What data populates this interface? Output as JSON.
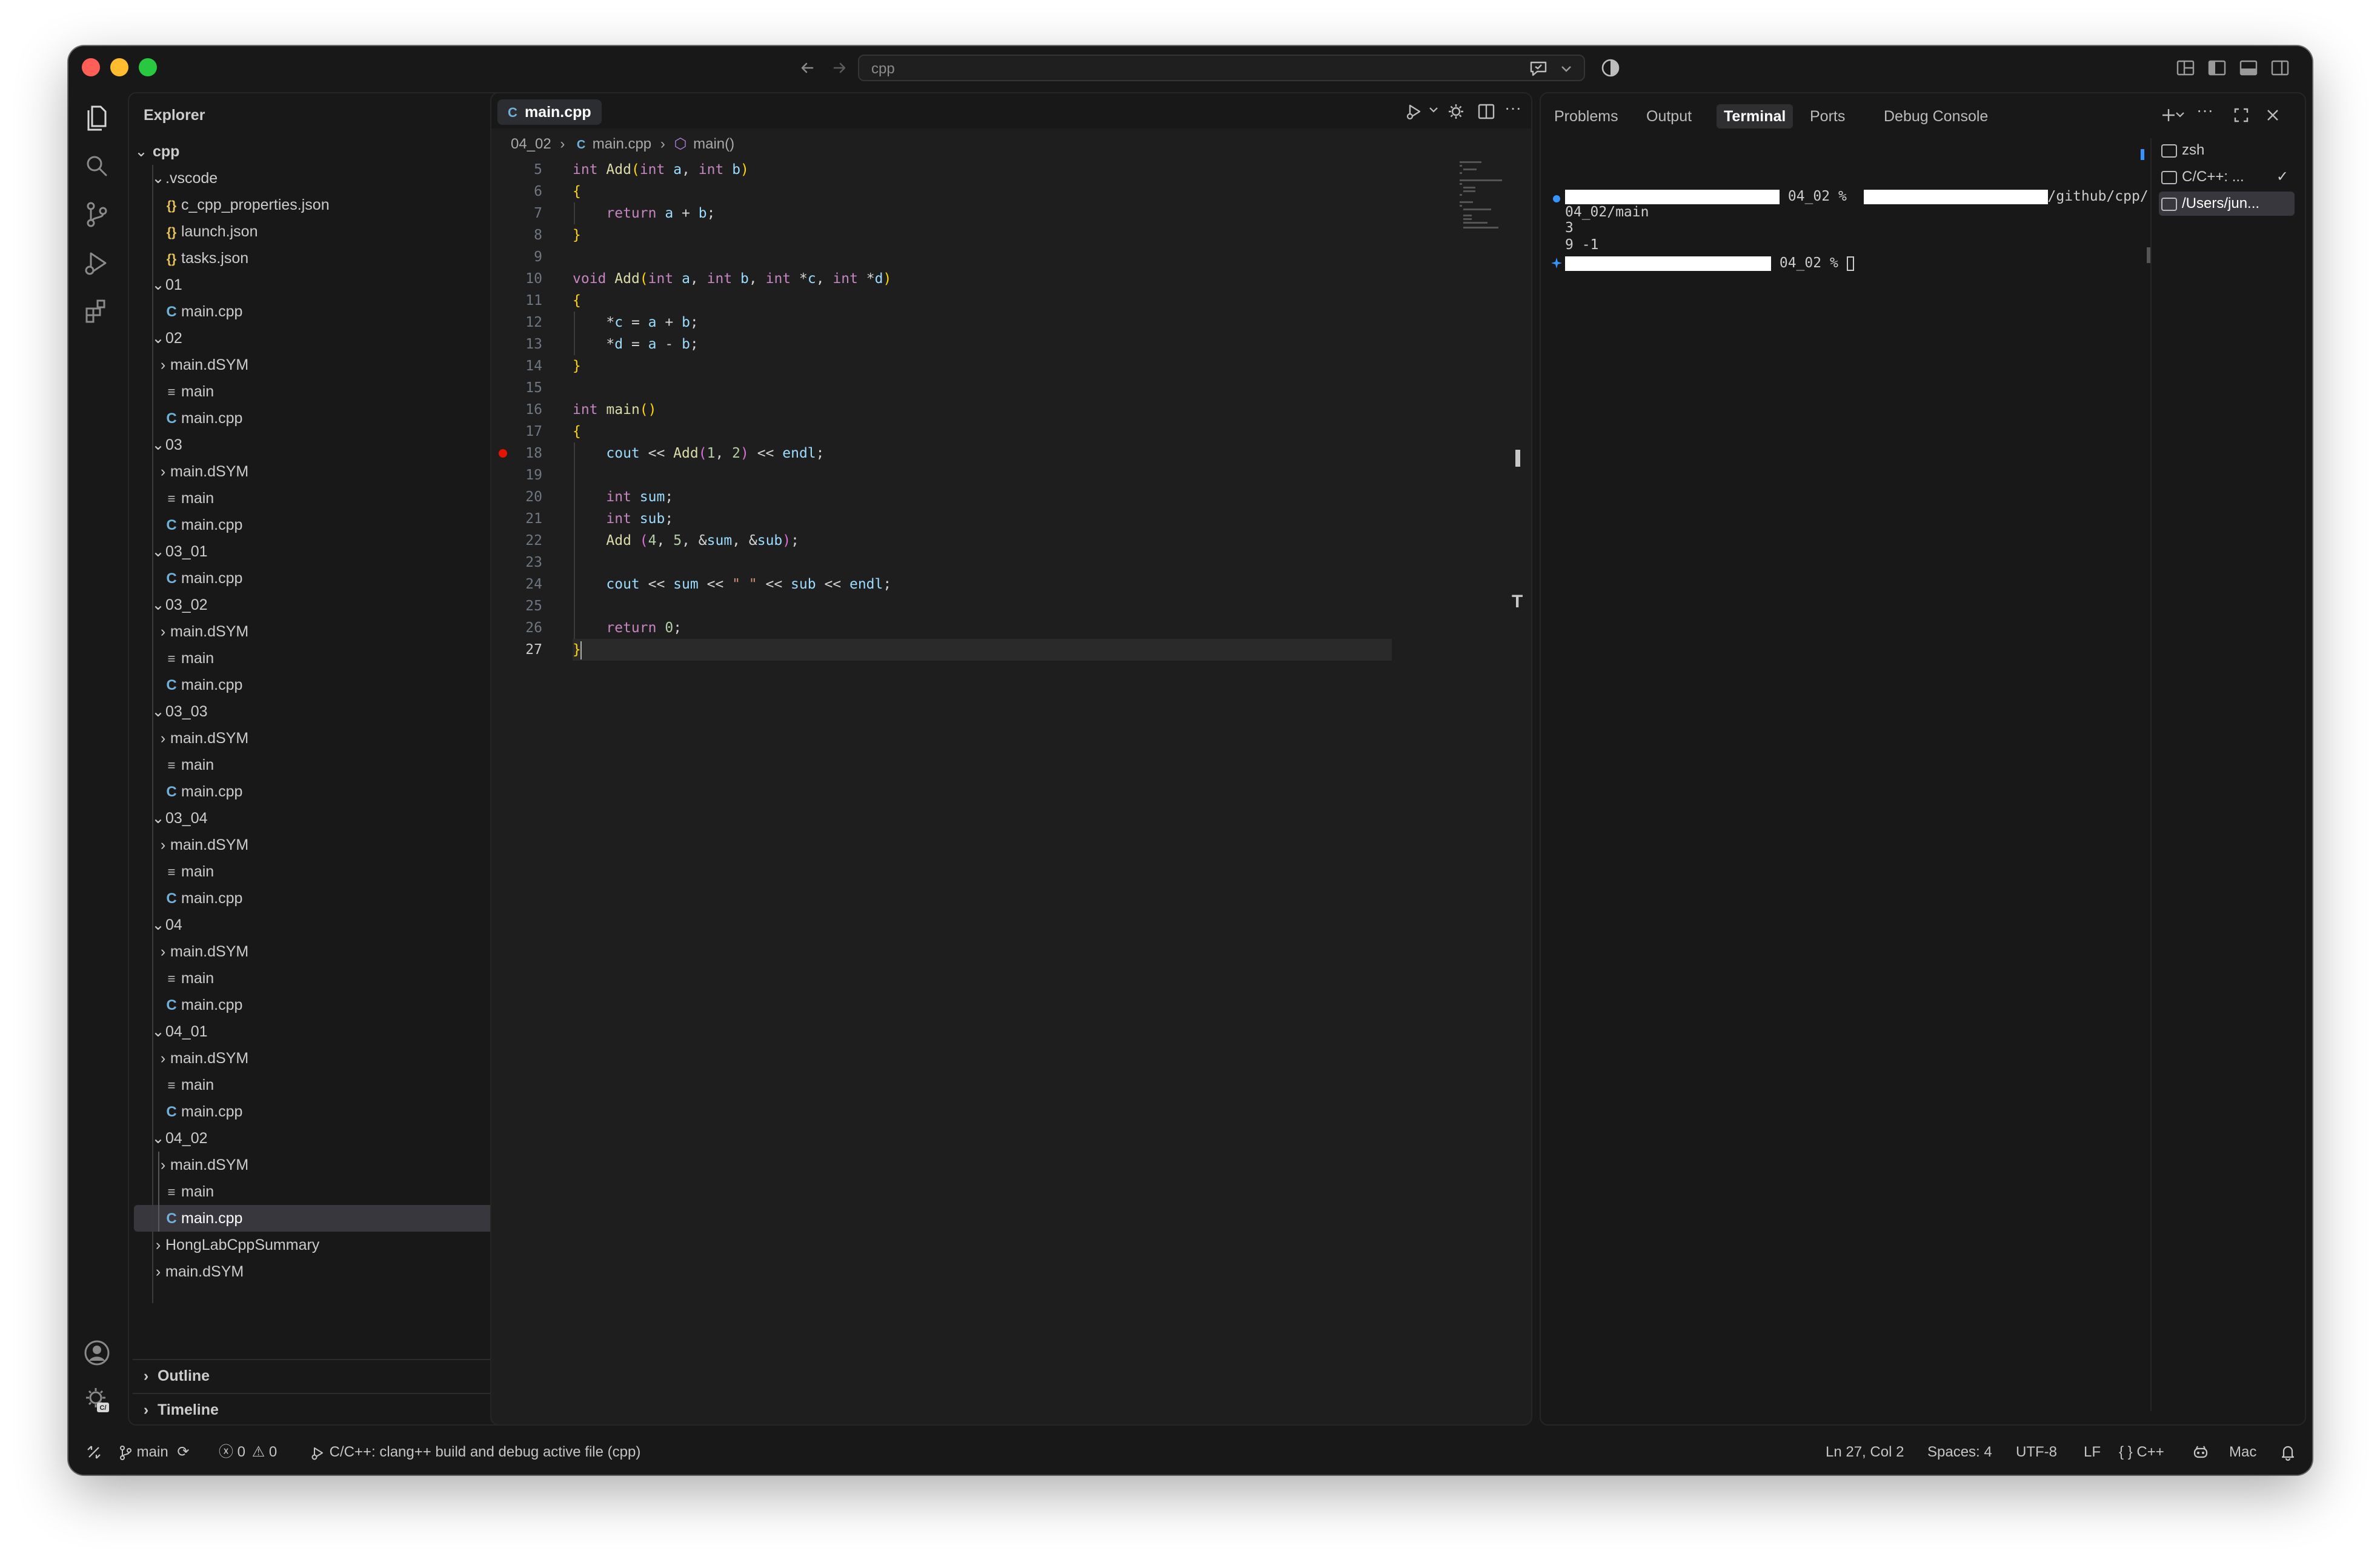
{
  "window": {
    "search_text": "cpp"
  },
  "sidebar": {
    "title": "Explorer",
    "more": "···",
    "root": "cpp",
    "items": [
      {
        "label": ".vscode",
        "kind": "folder-open"
      },
      {
        "label": "c_cpp_properties.json",
        "kind": "json"
      },
      {
        "label": "launch.json",
        "kind": "json"
      },
      {
        "label": "tasks.json",
        "kind": "json"
      },
      {
        "label": "01",
        "kind": "folder-open"
      },
      {
        "label": "main.cpp",
        "kind": "cpp"
      },
      {
        "label": "02",
        "kind": "folder-open"
      },
      {
        "label": "main.dSYM",
        "kind": "folder-closed"
      },
      {
        "label": "main",
        "kind": "bin"
      },
      {
        "label": "main.cpp",
        "kind": "cpp"
      },
      {
        "label": "03",
        "kind": "folder-open"
      },
      {
        "label": "main.dSYM",
        "kind": "folder-closed"
      },
      {
        "label": "main",
        "kind": "bin"
      },
      {
        "label": "main.cpp",
        "kind": "cpp"
      },
      {
        "label": "03_01",
        "kind": "folder-open"
      },
      {
        "label": "main.cpp",
        "kind": "cpp"
      },
      {
        "label": "03_02",
        "kind": "folder-open"
      },
      {
        "label": "main.dSYM",
        "kind": "folder-closed"
      },
      {
        "label": "main",
        "kind": "bin"
      },
      {
        "label": "main.cpp",
        "kind": "cpp"
      },
      {
        "label": "03_03",
        "kind": "folder-open"
      },
      {
        "label": "main.dSYM",
        "kind": "folder-closed"
      },
      {
        "label": "main",
        "kind": "bin"
      },
      {
        "label": "main.cpp",
        "kind": "cpp"
      },
      {
        "label": "03_04",
        "kind": "folder-open"
      },
      {
        "label": "main.dSYM",
        "kind": "folder-closed"
      },
      {
        "label": "main",
        "kind": "bin"
      },
      {
        "label": "main.cpp",
        "kind": "cpp"
      },
      {
        "label": "04",
        "kind": "folder-open"
      },
      {
        "label": "main.dSYM",
        "kind": "folder-closed"
      },
      {
        "label": "main",
        "kind": "bin"
      },
      {
        "label": "main.cpp",
        "kind": "cpp"
      },
      {
        "label": "04_01",
        "kind": "folder-open"
      },
      {
        "label": "main.dSYM",
        "kind": "folder-closed"
      },
      {
        "label": "main",
        "kind": "bin"
      },
      {
        "label": "main.cpp",
        "kind": "cpp"
      },
      {
        "label": "04_02",
        "kind": "folder-open"
      },
      {
        "label": "main.dSYM",
        "kind": "folder-closed"
      },
      {
        "label": "main",
        "kind": "bin"
      },
      {
        "label": "main.cpp",
        "kind": "cpp",
        "selected": true
      },
      {
        "label": "HongLabCppSummary",
        "kind": "folder-closed"
      },
      {
        "label": "main.dSYM",
        "kind": "folder-closed"
      }
    ],
    "outline": "Outline",
    "timeline": "Timeline"
  },
  "editor": {
    "tab_label": "main.cpp",
    "breadcrumb": {
      "folder": "04_02",
      "file": "main.cpp",
      "symbol": "main()"
    },
    "lines": [
      {
        "n": "5",
        "tokens": [
          [
            "ty",
            "int"
          ],
          [
            "op",
            " "
          ],
          [
            "fn",
            "Add"
          ],
          [
            "br",
            "("
          ],
          [
            "ty",
            "int"
          ],
          [
            "op",
            " "
          ],
          [
            "pm",
            "a"
          ],
          [
            "op",
            ", "
          ],
          [
            "ty",
            "int"
          ],
          [
            "op",
            " "
          ],
          [
            "pm",
            "b"
          ],
          [
            "br",
            ")"
          ]
        ]
      },
      {
        "n": "6",
        "tokens": [
          [
            "br",
            "{"
          ]
        ]
      },
      {
        "n": "7",
        "tokens": [
          [
            "op",
            "    "
          ],
          [
            "kw",
            "return"
          ],
          [
            "op",
            " "
          ],
          [
            "pm",
            "a"
          ],
          [
            "op",
            " + "
          ],
          [
            "pm",
            "b"
          ],
          [
            "op",
            ";"
          ]
        ]
      },
      {
        "n": "8",
        "tokens": [
          [
            "br",
            "}"
          ]
        ]
      },
      {
        "n": "9",
        "tokens": []
      },
      {
        "n": "10",
        "tokens": [
          [
            "ty",
            "void"
          ],
          [
            "op",
            " "
          ],
          [
            "fn",
            "Add"
          ],
          [
            "br",
            "("
          ],
          [
            "ty",
            "int"
          ],
          [
            "op",
            " "
          ],
          [
            "pm",
            "a"
          ],
          [
            "op",
            ", "
          ],
          [
            "ty",
            "int"
          ],
          [
            "op",
            " "
          ],
          [
            "pm",
            "b"
          ],
          [
            "op",
            ", "
          ],
          [
            "ty",
            "int"
          ],
          [
            "op",
            " *"
          ],
          [
            "pm",
            "c"
          ],
          [
            "op",
            ", "
          ],
          [
            "ty",
            "int"
          ],
          [
            "op",
            " *"
          ],
          [
            "pm",
            "d"
          ],
          [
            "br",
            ")"
          ]
        ]
      },
      {
        "n": "11",
        "tokens": [
          [
            "br",
            "{"
          ]
        ]
      },
      {
        "n": "12",
        "tokens": [
          [
            "op",
            "    *"
          ],
          [
            "pm",
            "c"
          ],
          [
            "op",
            " = "
          ],
          [
            "pm",
            "a"
          ],
          [
            "op",
            " + "
          ],
          [
            "pm",
            "b"
          ],
          [
            "op",
            ";"
          ]
        ]
      },
      {
        "n": "13",
        "tokens": [
          [
            "op",
            "    *"
          ],
          [
            "pm",
            "d"
          ],
          [
            "op",
            " = "
          ],
          [
            "pm",
            "a"
          ],
          [
            "op",
            " - "
          ],
          [
            "pm",
            "b"
          ],
          [
            "op",
            ";"
          ]
        ]
      },
      {
        "n": "14",
        "tokens": [
          [
            "br",
            "}"
          ]
        ]
      },
      {
        "n": "15",
        "tokens": []
      },
      {
        "n": "16",
        "tokens": [
          [
            "ty",
            "int"
          ],
          [
            "op",
            " "
          ],
          [
            "fn",
            "main"
          ],
          [
            "br",
            "()"
          ]
        ]
      },
      {
        "n": "17",
        "tokens": [
          [
            "br",
            "{"
          ]
        ]
      },
      {
        "n": "18",
        "tokens": [
          [
            "op",
            "    "
          ],
          [
            "pm",
            "cout"
          ],
          [
            "op",
            " << "
          ],
          [
            "fn",
            "Add"
          ],
          [
            "br2",
            "("
          ],
          [
            "nu",
            "1"
          ],
          [
            "op",
            ", "
          ],
          [
            "nu",
            "2"
          ],
          [
            "br2",
            ")"
          ],
          [
            "op",
            " << "
          ],
          [
            "pm",
            "endl"
          ],
          [
            "op",
            ";"
          ]
        ],
        "breakpoint": true
      },
      {
        "n": "19",
        "tokens": []
      },
      {
        "n": "20",
        "tokens": [
          [
            "op",
            "    "
          ],
          [
            "ty",
            "int"
          ],
          [
            "op",
            " "
          ],
          [
            "pm",
            "sum"
          ],
          [
            "op",
            ";"
          ]
        ]
      },
      {
        "n": "21",
        "tokens": [
          [
            "op",
            "    "
          ],
          [
            "ty",
            "int"
          ],
          [
            "op",
            " "
          ],
          [
            "pm",
            "sub"
          ],
          [
            "op",
            ";"
          ]
        ]
      },
      {
        "n": "22",
        "tokens": [
          [
            "op",
            "    "
          ],
          [
            "fn",
            "Add"
          ],
          [
            "op",
            " "
          ],
          [
            "br2",
            "("
          ],
          [
            "nu",
            "4"
          ],
          [
            "op",
            ", "
          ],
          [
            "nu",
            "5"
          ],
          [
            "op",
            ", &"
          ],
          [
            "pm",
            "sum"
          ],
          [
            "op",
            ", &"
          ],
          [
            "pm",
            "sub"
          ],
          [
            "br2",
            ")"
          ],
          [
            "op",
            ";"
          ]
        ]
      },
      {
        "n": "23",
        "tokens": []
      },
      {
        "n": "24",
        "tokens": [
          [
            "op",
            "    "
          ],
          [
            "pm",
            "cout"
          ],
          [
            "op",
            " << "
          ],
          [
            "pm",
            "sum"
          ],
          [
            "op",
            " << "
          ],
          [
            "st",
            "\" \""
          ],
          [
            "op",
            " << "
          ],
          [
            "pm",
            "sub"
          ],
          [
            "op",
            " << "
          ],
          [
            "pm",
            "endl"
          ],
          [
            "op",
            ";"
          ]
        ]
      },
      {
        "n": "25",
        "tokens": []
      },
      {
        "n": "26",
        "tokens": [
          [
            "op",
            "    "
          ],
          [
            "kw",
            "return"
          ],
          [
            "op",
            " "
          ],
          [
            "nu",
            "0"
          ],
          [
            "op",
            ";"
          ]
        ]
      },
      {
        "n": "27",
        "tokens": [
          [
            "br",
            "}"
          ]
        ],
        "current": true
      }
    ]
  },
  "panel": {
    "tabs": [
      "Problems",
      "Output",
      "Terminal",
      "Ports",
      "Debug Console"
    ],
    "active_tab": "Terminal",
    "terminal": {
      "line1_dir": "04_02 %",
      "line1_path": "/github/cpp/",
      "line2": "04_02/main",
      "line3": "3",
      "line4": "9 -1",
      "line5_dir": "04_02 %"
    },
    "terminals": [
      {
        "label": "zsh"
      },
      {
        "label": "C/C++: ...",
        "check": "✓"
      },
      {
        "label": "/Users/jun..."
      }
    ]
  },
  "status": {
    "branch": "main",
    "errors": "0",
    "warnings": "0",
    "task": "C/C++: clang++ build and debug active file (cpp)",
    "position": "Ln 27, Col 2",
    "spaces": "Spaces: 4",
    "encoding": "UTF-8",
    "eol": "LF",
    "language": "C++",
    "platform": "Mac"
  },
  "colors": {
    "accent": "#3794ff",
    "breakpoint": "#e51400",
    "json_icon": "#e8c45a",
    "cpp_icon": "#6fb1d8"
  },
  "icons": {
    "activity": [
      "explorer-icon",
      "search-icon",
      "source-control-icon",
      "run-debug-icon",
      "extensions-icon",
      "account-icon",
      "manage-gear-icon"
    ]
  }
}
